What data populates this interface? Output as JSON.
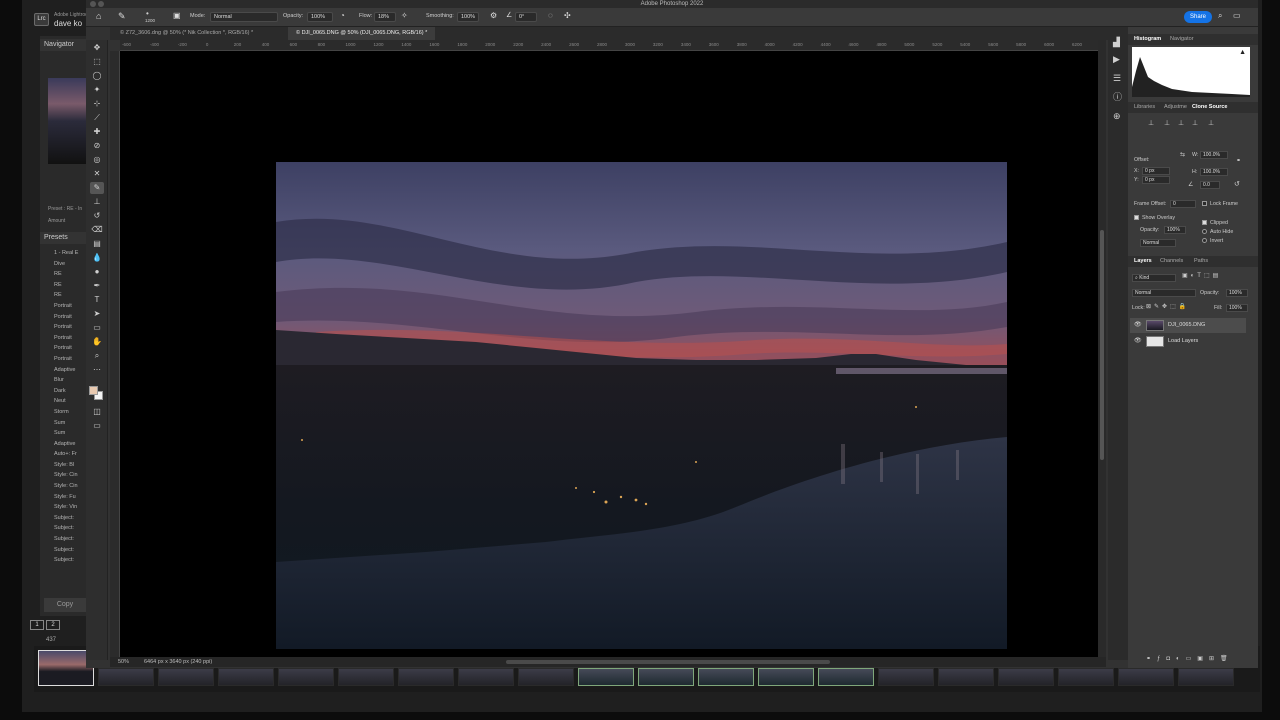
{
  "lightroom": {
    "logo": "Lrc",
    "app_name": "Adobe Lightroom",
    "user": "dave ko",
    "navigator_label": "Navigator",
    "preset_label": "Preset : RE - In",
    "amount_label": "Amount",
    "presets_header": "Presets",
    "preset_items": [
      "1 - Real E",
      "Dive",
      "RE",
      "RE",
      "RE",
      "Portrait",
      "Portrait",
      "Portrait",
      "Portrait",
      "Portrait",
      "Portrait",
      "Adaptive",
      "Blur",
      "Dark",
      "Neut",
      "Storm",
      "Sum",
      "Sum",
      "Adaptive",
      "Auto+: Fr",
      "Style: Bl",
      "Style: Cin",
      "Style: Cin",
      "Style: Fu",
      "Style: Vin",
      "Subject:",
      "Subject:",
      "Subject:",
      "Subject:",
      "Subject:"
    ],
    "copy_button": "Copy",
    "view_numbers": [
      "1",
      "2"
    ],
    "photo_count": "437"
  },
  "photoshop": {
    "window_title": "Adobe Photoshop 2022",
    "options": {
      "brush_size": "1200",
      "mode_label": "Mode:",
      "mode_value": "Normal",
      "opacity_label": "Opacity:",
      "opacity_value": "100%",
      "flow_label": "Flow:",
      "flow_value": "18%",
      "smoothing_label": "Smoothing:",
      "smoothing_value": "100%",
      "angle_value": "0°",
      "share_label": "Share"
    },
    "tabs": [
      {
        "label": "© Z72_3606.dng @ 50% (* Nik Collection *, RGB/16) *",
        "active": false
      },
      {
        "label": "© DJI_0065.DNG @ 50% (DJI_0065.DNG, RGB/16) *",
        "active": true
      }
    ],
    "ruler_ticks": [
      "-600",
      "-400",
      "-200",
      "0",
      "200",
      "400",
      "600",
      "800",
      "1000",
      "1200",
      "1400",
      "1600",
      "1800",
      "2000",
      "2200",
      "2400",
      "2600",
      "2800",
      "3000",
      "3200",
      "3400",
      "3600",
      "3800",
      "4000",
      "4200",
      "4400",
      "4600",
      "4800",
      "5000",
      "5200",
      "5400",
      "5600",
      "5800",
      "6000",
      "6200"
    ],
    "status": {
      "zoom": "50%",
      "doc_info": "6464 px x 3640 px (240 ppi)"
    },
    "panels": {
      "top_tabs": [
        "Histogram",
        "Navigator"
      ],
      "mid_tabs": [
        "Libraries",
        "Adjustme",
        "Clone Source"
      ],
      "clone_source": {
        "offset_label": "Offset:",
        "x_label": "X:",
        "x_value": "0 px",
        "y_label": "Y:",
        "y_value": "0 px",
        "w_label": "W:",
        "w_value": "100.0%",
        "h_label": "H:",
        "h_value": "100.0%",
        "angle_value": "0.0",
        "frame_offset_label": "Frame Offset:",
        "frame_offset_value": "0",
        "lock_frame_label": "Lock Frame",
        "show_overlay_label": "Show Overlay",
        "opacity_label": "Opacity:",
        "opacity_value": "100%",
        "blend_mode": "Normal",
        "clipped_label": "Clipped",
        "auto_hide_label": "Auto Hide",
        "invert_label": "Invert"
      },
      "layer_tabs": [
        "Layers",
        "Channels",
        "Paths"
      ],
      "layers": {
        "kind_label": "Kind",
        "blend_mode": "Normal",
        "opacity_label": "Opacity:",
        "opacity_value": "100%",
        "lock_label": "Lock:",
        "fill_label": "Fill:",
        "fill_value": "100%",
        "items": [
          {
            "name": "DJI_0065.DNG",
            "selected": true
          },
          {
            "name": "Load Layers",
            "selected": false
          }
        ]
      }
    }
  }
}
